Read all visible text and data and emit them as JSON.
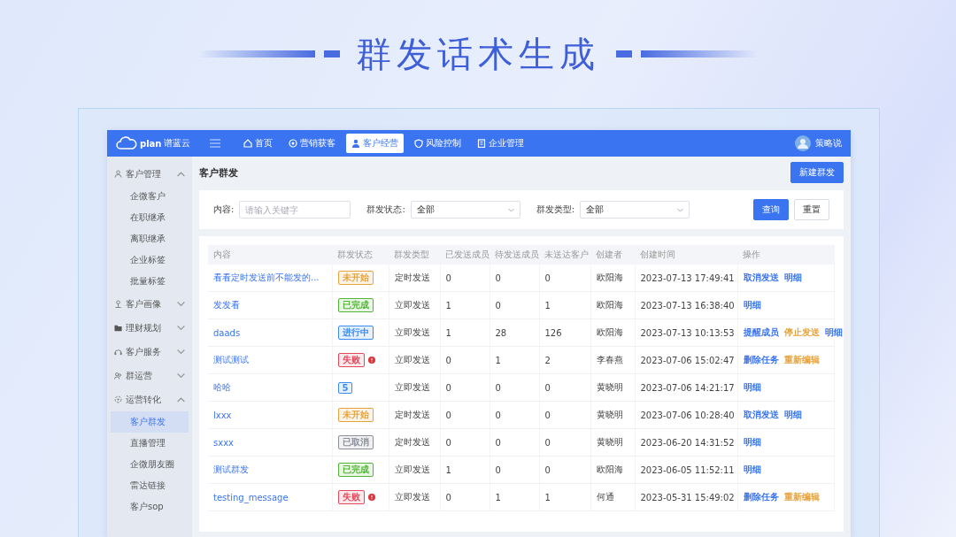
{
  "banner": {
    "title": "群发话术生成"
  },
  "header": {
    "logo_text": "plan",
    "brand": "谱蓝云",
    "user": "策略说",
    "nav": [
      {
        "label": "首页",
        "selected": false
      },
      {
        "label": "营销获客",
        "selected": false
      },
      {
        "label": "客户经营",
        "selected": true
      },
      {
        "label": "风险控制",
        "selected": false
      },
      {
        "label": "企业管理",
        "selected": false
      }
    ]
  },
  "sidebar": {
    "groups": [
      {
        "label": "客户管理",
        "expanded": true,
        "children": [
          {
            "label": "企微客户",
            "selected": false
          },
          {
            "label": "在职继承",
            "selected": false
          },
          {
            "label": "离职继承",
            "selected": false
          },
          {
            "label": "企业标签",
            "selected": false
          },
          {
            "label": "批量标签",
            "selected": false
          }
        ]
      },
      {
        "label": "客户画像",
        "expanded": false
      },
      {
        "label": "理财规划",
        "expanded": false
      },
      {
        "label": "客户服务",
        "expanded": false
      },
      {
        "label": "群运营",
        "expanded": false
      },
      {
        "label": "运营转化",
        "expanded": true,
        "children": [
          {
            "label": "客户群发",
            "selected": true
          },
          {
            "label": "直播管理",
            "selected": false
          },
          {
            "label": "企微朋友圈",
            "selected": false
          },
          {
            "label": "雷达链接",
            "selected": false
          },
          {
            "label": "客户sop",
            "selected": false
          }
        ]
      }
    ]
  },
  "page": {
    "title": "客户群发",
    "new_button": "新建群发"
  },
  "filters": {
    "fields": [
      {
        "label": "内容:",
        "kind": "input",
        "placeholder": "请输入关键字"
      },
      {
        "label": "群发状态:",
        "kind": "select",
        "value": "全部"
      },
      {
        "label": "群发类型:",
        "kind": "select",
        "value": "全部"
      }
    ],
    "buttons": [
      {
        "label": "查询",
        "primary": true
      },
      {
        "label": "重置",
        "primary": false
      }
    ]
  },
  "table": {
    "columns": [
      "内容",
      "群发状态",
      "群发类型",
      "已发送成员",
      "待发送成员",
      "未送达客户",
      "创建者",
      "创建时间",
      "操作"
    ],
    "rows": [
      {
        "content": "看看定时发送前不能发的...",
        "status": {
          "label": "未开始",
          "color": "#e6a23c",
          "failed": false
        },
        "type": "定时发送",
        "sent": "0",
        "pending": "0",
        "undelivered": "0",
        "creator": "欧阳海",
        "created": "2023-07-13 17:49:41",
        "actions": [
          {
            "label": "取消发送",
            "color": "#3b74f0"
          },
          {
            "label": "明细",
            "color": "#3b74f0"
          }
        ]
      },
      {
        "content": "发发看",
        "status": {
          "label": "已完成",
          "color": "#52b535",
          "failed": false
        },
        "type": "立即发送",
        "sent": "1",
        "pending": "0",
        "undelivered": "1",
        "creator": "欧阳海",
        "created": "2023-07-13 16:38:40",
        "actions": [
          {
            "label": "明细",
            "color": "#3b74f0"
          }
        ]
      },
      {
        "content": "daads",
        "status": {
          "label": "进行中",
          "color": "#3b8cf0",
          "failed": false
        },
        "type": "立即发送",
        "sent": "1",
        "pending": "28",
        "undelivered": "126",
        "creator": "欧阳海",
        "created": "2023-07-13 10:13:53",
        "actions": [
          {
            "label": "提醒成员",
            "color": "#3b74f0"
          },
          {
            "label": "停止发送",
            "color": "#e6a23c"
          },
          {
            "label": "明细",
            "color": "#3b74f0"
          }
        ]
      },
      {
        "content": "测试测试",
        "status": {
          "label": "失败",
          "color": "#e5485a",
          "failed": true
        },
        "type": "立即发送",
        "sent": "0",
        "pending": "1",
        "undelivered": "2",
        "creator": "李春燕",
        "created": "2023-07-06 15:02:47",
        "actions": [
          {
            "label": "删除任务",
            "color": "#3b74f0"
          },
          {
            "label": "重新编辑",
            "color": "#e6a23c"
          }
        ]
      },
      {
        "content": "哈哈",
        "status": {
          "label": "5",
          "color": "#3b8cf0",
          "failed": false
        },
        "type": "立即发送",
        "sent": "0",
        "pending": "0",
        "undelivered": "0",
        "creator": "黄晓明",
        "created": "2023-07-06 14:21:17",
        "actions": [
          {
            "label": "明细",
            "color": "#3b74f0"
          }
        ]
      },
      {
        "content": "lxxx",
        "status": {
          "label": "未开始",
          "color": "#e6a23c",
          "failed": false
        },
        "type": "定时发送",
        "sent": "0",
        "pending": "0",
        "undelivered": "0",
        "creator": "黄晓明",
        "created": "2023-07-06 10:28:40",
        "actions": [
          {
            "label": "取消发送",
            "color": "#3b74f0"
          },
          {
            "label": "明细",
            "color": "#3b74f0"
          }
        ]
      },
      {
        "content": "sxxx",
        "status": {
          "label": "已取消",
          "color": "#8a8f99",
          "failed": false
        },
        "type": "定时发送",
        "sent": "0",
        "pending": "0",
        "undelivered": "0",
        "creator": "黄晓明",
        "created": "2023-06-20 14:31:52",
        "actions": [
          {
            "label": "明细",
            "color": "#3b74f0"
          }
        ]
      },
      {
        "content": "测试群发",
        "status": {
          "label": "已完成",
          "color": "#52b535",
          "failed": false
        },
        "type": "立即发送",
        "sent": "1",
        "pending": "0",
        "undelivered": "0",
        "creator": "欧阳海",
        "created": "2023-06-05 11:52:11",
        "actions": [
          {
            "label": "明细",
            "color": "#3b74f0"
          }
        ]
      },
      {
        "content": "testing_message",
        "status": {
          "label": "失败",
          "color": "#e5485a",
          "failed": true
        },
        "type": "立即发送",
        "sent": "0",
        "pending": "1",
        "undelivered": "1",
        "creator": "何通",
        "created": "2023-05-31 15:49:02",
        "actions": [
          {
            "label": "删除任务",
            "color": "#3b74f0"
          },
          {
            "label": "重新编辑",
            "color": "#e6a23c"
          }
        ]
      }
    ]
  }
}
